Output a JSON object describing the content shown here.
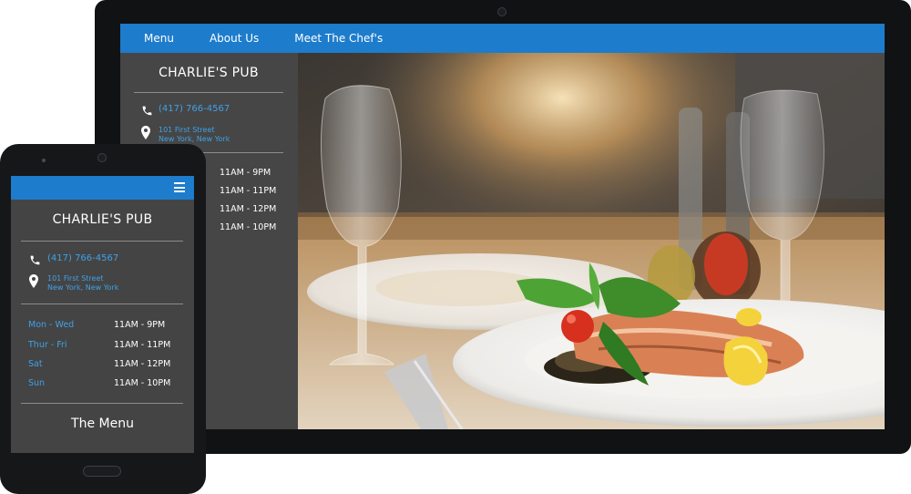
{
  "desktop": {
    "nav": [
      {
        "label": "Menu"
      },
      {
        "label": "About Us"
      },
      {
        "label": "Meet The Chef's"
      }
    ],
    "sidebar": {
      "title": "CHARLIE'S PUB",
      "phone": "(417) 766-4567",
      "address_line1": "101 First Street",
      "address_line2": "New York, New York",
      "hours": [
        {
          "time": "11AM - 9PM"
        },
        {
          "time": "11AM - 11PM"
        },
        {
          "time": "11AM - 12PM"
        },
        {
          "time": "11AM - 10PM"
        }
      ]
    }
  },
  "tablet": {
    "title": "CHARLIE'S PUB",
    "phone": "(417) 766-4567",
    "address_line1": "101 First Street",
    "address_line2": "New York, New York",
    "hours": [
      {
        "day": "Mon - Wed",
        "time": "11AM - 9PM"
      },
      {
        "day": "Thur - Fri",
        "time": "11AM - 11PM"
      },
      {
        "day": "Sat",
        "time": "11AM - 12PM"
      },
      {
        "day": "Sun",
        "time": "11AM - 10PM"
      }
    ],
    "menu_heading": "The Menu"
  },
  "icons": {
    "phone": "phone-icon",
    "location": "map-pin-icon",
    "menu": "hamburger-menu-icon"
  },
  "colors": {
    "accent": "#1d7ccc",
    "link": "#3fa2e8",
    "panel": "#464646",
    "device": "#111214"
  }
}
